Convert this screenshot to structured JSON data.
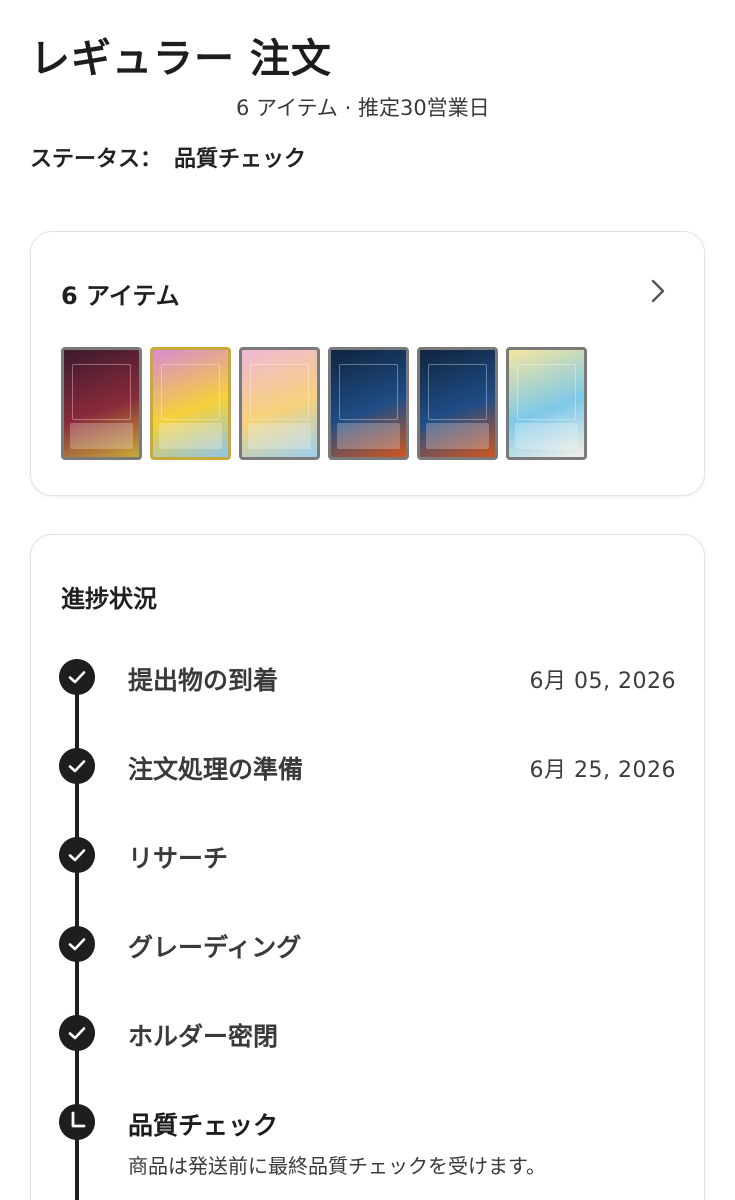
{
  "order": {
    "title": "レギュラー 注文",
    "meta": "6 アイテム · 推定30営業日",
    "status_label": "ステータス：",
    "status_value": "品質チェック"
  },
  "items_card": {
    "title": "6 アイテム",
    "thumbnails": [
      {
        "name": "card-1",
        "colors": [
          "#3b1a2e",
          "#8a2a3a",
          "#c9a93a"
        ]
      },
      {
        "name": "card-2",
        "colors": [
          "#d98ad0",
          "#f5d13b",
          "#8ec5e8"
        ]
      },
      {
        "name": "card-3",
        "colors": [
          "#f0b8d8",
          "#f6d27a",
          "#9ad0f0"
        ]
      },
      {
        "name": "card-4",
        "colors": [
          "#10243f",
          "#1f4d86",
          "#d2561e"
        ]
      },
      {
        "name": "card-5",
        "colors": [
          "#10243f",
          "#1f4d86",
          "#d2561e"
        ]
      },
      {
        "name": "card-6",
        "colors": [
          "#f5e6a0",
          "#7ec8e8",
          "#f4f0e6"
        ]
      }
    ]
  },
  "progress": {
    "title": "進捗状況",
    "steps": [
      {
        "label": "提出物の到着",
        "date": "6月 05, 2026",
        "icon": "check-icon"
      },
      {
        "label": "注文処理の準備",
        "date": "6月 25, 2026",
        "icon": "check-icon"
      },
      {
        "label": "リサーチ",
        "date": "",
        "icon": "check-icon"
      },
      {
        "label": "グレーディング",
        "date": "",
        "icon": "check-icon"
      },
      {
        "label": "ホルダー密閉",
        "date": "",
        "icon": "check-icon"
      },
      {
        "label": "品質チェック",
        "date": "",
        "icon": "clock-icon",
        "description": "商品は発送前に最終品質チェックを受けます。"
      }
    ]
  }
}
